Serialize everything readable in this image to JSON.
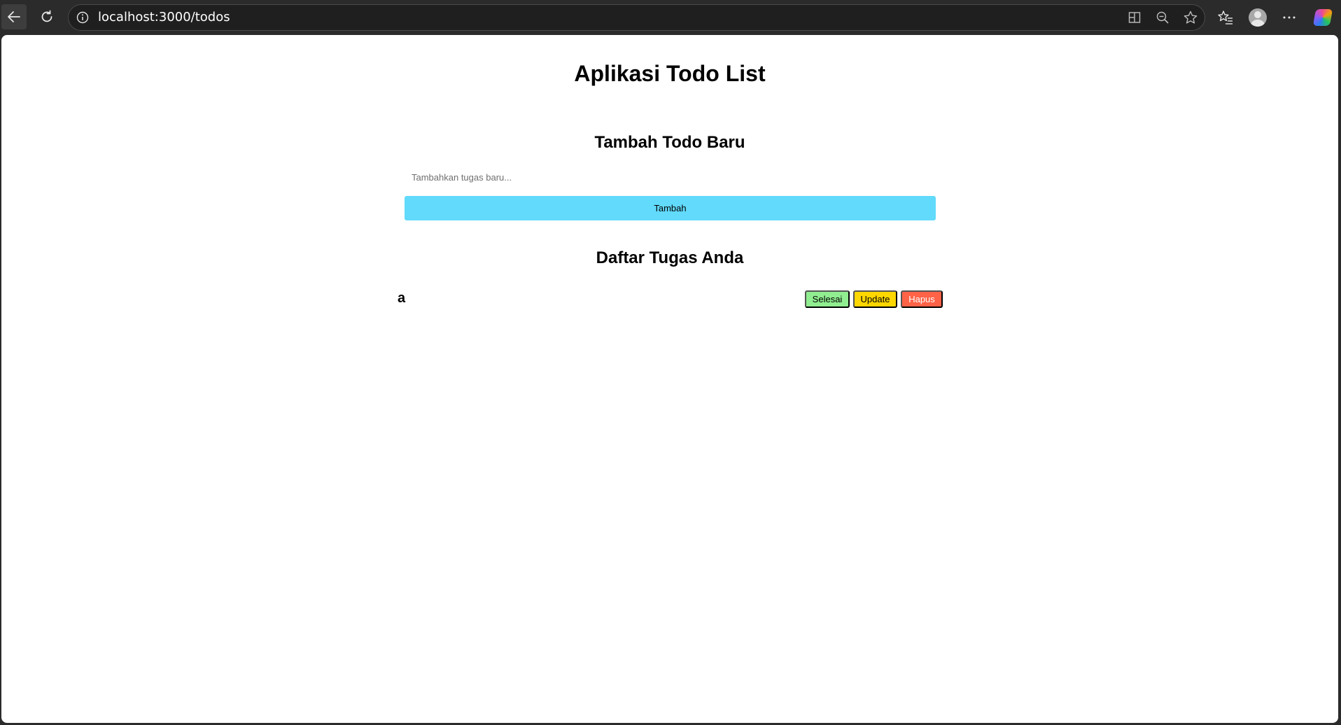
{
  "browser": {
    "url": "localhost:3000/todos"
  },
  "page": {
    "title": "Aplikasi Todo List",
    "add_section": {
      "heading": "Tambah Todo Baru",
      "input_placeholder": "Tambahkan tugas baru...",
      "input_value": "",
      "add_button_label": "Tambah"
    },
    "list_section": {
      "heading": "Daftar Tugas Anda",
      "todos": [
        {
          "text": "a",
          "done_label": "Selesai",
          "update_label": "Update",
          "delete_label": "Hapus"
        }
      ]
    }
  },
  "colors": {
    "add_button": "#61dafb",
    "done_button": "#90ee90",
    "update_button": "#ffd700",
    "delete_button": "#ff6347"
  },
  "icons": {
    "toolbar": [
      "back-arrow-icon",
      "reload-icon",
      "site-info-icon",
      "split-screen-icon",
      "zoom-out-icon",
      "favorite-star-icon",
      "favorites-list-icon",
      "profile-avatar-icon",
      "more-options-icon",
      "copilot-icon"
    ]
  }
}
